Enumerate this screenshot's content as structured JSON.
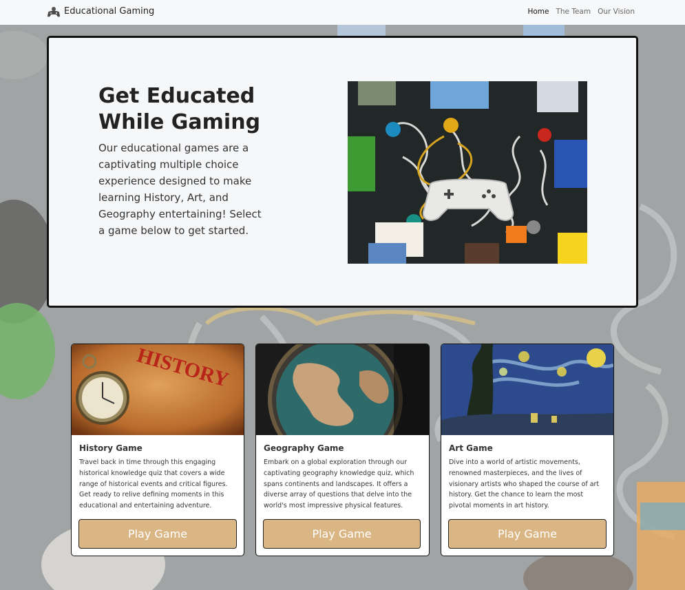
{
  "nav": {
    "brand": "Educational Gaming",
    "links": [
      "Home",
      "The Team",
      "Our Vision"
    ]
  },
  "hero": {
    "title": "Get Educated While Gaming",
    "description": "Our educational games are a captivating multiple choice experience designed to make learning History, Art, and Geography entertaining! Select a game below to get started."
  },
  "cards": [
    {
      "title": "History Game",
      "description": "Travel back in time through this engaging historical knowledge quiz that covers a wide range of historical events and critical figures. Get ready to relive defining moments in this educational and entertaining adventure.",
      "button": "Play Game",
      "image_text": "HISTORY"
    },
    {
      "title": "Geography Game",
      "description": "Embark on a global exploration through our captivating geography knowledge quiz, which spans continents and landscapes. It offers a diverse array of questions that delve into the world's most impressive physical features.",
      "button": "Play Game"
    },
    {
      "title": "Art Game",
      "description": "Dive into a world of artistic movements, renowned masterpieces, and the lives of visionary artists who shaped the course of art history. Get the chance to learn the most pivotal moments in art history.",
      "button": "Play Game"
    }
  ],
  "colors": {
    "button_bg": "#dbb685",
    "hero_bg": "#f6f7f9",
    "nav_bg": "#f7f8f9",
    "background": "#8b8f90"
  },
  "icons": {
    "brand": "gamepad-icon"
  }
}
